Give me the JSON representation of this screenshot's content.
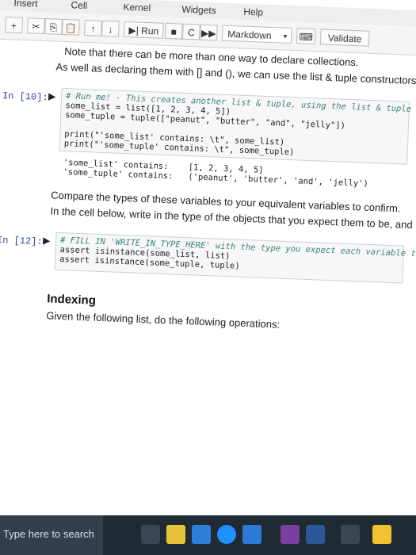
{
  "menubar": {
    "items": [
      "Insert",
      "Cell",
      "Kernel",
      "Widgets",
      "Help"
    ]
  },
  "toolbar": {
    "run_label": "Run",
    "cell_type": "Markdown",
    "validate_label": "Validate"
  },
  "notebook": {
    "note_text": "Note that there can be more than one way to declare collections.",
    "intro_text": "As well as declaring them with [] and (), we can use the list & tuple constructors, as shown below.",
    "cell1": {
      "prompt": "In [10]:",
      "lines": [
        "# Run me! - This creates another list & tuple, using the list & tuple constructors",
        "some_list = list([1, 2, 3, 4, 5])",
        "some_tuple = tuple([\"peanut\", \"butter\", \"and\", \"jelly\"])",
        "",
        "print(\"'some_list' contains: \\t\", some_list)",
        "print(\"'some_tuple' contains: \\t\", some_tuple)"
      ],
      "output": [
        "'some_list' contains:    [1, 2, 3, 4, 5]",
        "'some_tuple' contains:   ('peanut', 'butter', 'and', 'jelly')"
      ]
    },
    "compare_text": "Compare the types of these variables to your equivalent variables to confirm.",
    "instruction_text": "In the cell below, write in the type of the objects that you expect them to be, and make sure the asserts pass.",
    "cell2": {
      "prompt": "In [12]:",
      "lines": [
        "# FILL IN 'WRITE_IN_TYPE_HERE' with the type you expect each variable to be",
        "assert isinstance(some_list, list)",
        "assert isinstance(some_tuple, tuple)"
      ]
    },
    "heading": "Indexing",
    "heading_text": "Given the following list, do the following operations:"
  },
  "taskbar": {
    "search_placeholder": "Type here to search",
    "icons": [
      "task-view-icon",
      "file-explorer-icon",
      "chrome-icon",
      "edge-icon",
      "store-icon",
      "onenote-icon",
      "word-icon",
      "settings-icon",
      "sticky-notes-icon"
    ]
  }
}
